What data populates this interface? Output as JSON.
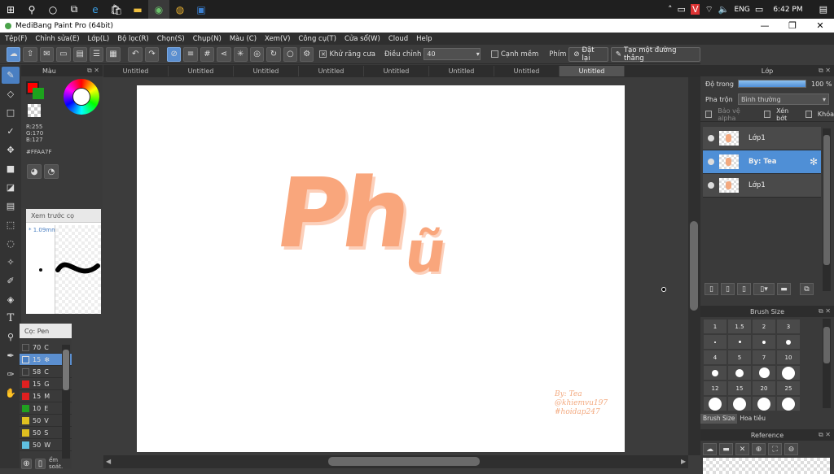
{
  "taskbar": {
    "language": "ENG",
    "time": "6:42 PM"
  },
  "window": {
    "title": "MediBang Paint Pro (64bit)",
    "minimize": "—",
    "restore": "❐",
    "close": "✕"
  },
  "menu": [
    "Tệp(F)",
    "Chỉnh sửa(E)",
    "Lớp(L)",
    "Bộ lọc(R)",
    "Chọn(S)",
    "Chụp(N)",
    "Màu (C)",
    "Xem(V)",
    "Công cụ(T)",
    "Cửa sổ(W)",
    "Cloud",
    "Help"
  ],
  "toolbar": {
    "antialias_label": "Khử răng cưa",
    "adjust_label": "Điều chỉnh",
    "adjust_value": "40",
    "sharp_label": "Cạnh mềm",
    "key_label": "Phím",
    "reset_label": "Đặt lại",
    "line_label": "Tạo một đường thẳng"
  },
  "color_panel": {
    "title": "Màu",
    "r": "R:255",
    "g": "G:170",
    "b": "B:127",
    "hex": "#FFAA7F"
  },
  "preview_panel": {
    "title": "Xem trước cọ",
    "size": "* 1.09mm"
  },
  "brush_panel": {
    "title": "Cọ: Pen",
    "items": [
      {
        "size": "70",
        "name": "C",
        "color": "#3a3a3a"
      },
      {
        "size": "15",
        "name": "",
        "color": "#4a7fc2"
      },
      {
        "size": "58",
        "name": "C",
        "color": "#3a3a3a"
      },
      {
        "size": "15",
        "name": "G",
        "color": "#e02020"
      },
      {
        "size": "15",
        "name": "M",
        "color": "#e02020"
      },
      {
        "size": "10",
        "name": "E",
        "color": "#20a020"
      },
      {
        "size": "50",
        "name": "V",
        "color": "#e0c020"
      },
      {
        "size": "50",
        "name": "S",
        "color": "#e0c020"
      },
      {
        "size": "50",
        "name": "W",
        "color": "#60c0e0"
      }
    ],
    "footer": "ểm soát."
  },
  "tabs": [
    "Untitled",
    "Untitled",
    "Untitled",
    "Untitled",
    "Untitled",
    "Untitled",
    "Untitled",
    "Untitled"
  ],
  "canvas": {
    "art_text_1": "Ph",
    "art_text_2": "ũ",
    "signature_1": "By: Tea",
    "signature_2": "@khiemvu197",
    "signature_3": "#hoidap247"
  },
  "layer_panel": {
    "title": "Lớp",
    "opacity_label": "Độ trong",
    "opacity_value": "100 %",
    "blend_label": "Pha trộn",
    "blend_value": "Bình thường",
    "protect_alpha": "Bảo vệ alpha",
    "clip": "Xén bớt",
    "lock": "Khóa",
    "layers": [
      "Lớp1",
      "By: Tea",
      "Lớp1"
    ]
  },
  "brush_size_panel": {
    "title": "Brush Size",
    "sizes": [
      "1",
      "1.5",
      "2",
      "3",
      "4",
      "5",
      "7",
      "10",
      "12",
      "15",
      "20",
      "25"
    ],
    "tab1": "Brush Size",
    "tab2": "Hoa tiêu"
  },
  "reference_panel": {
    "title": "Reference"
  },
  "colors": {
    "accent": "#4f8fd6",
    "paint": "#FFAA7F"
  }
}
